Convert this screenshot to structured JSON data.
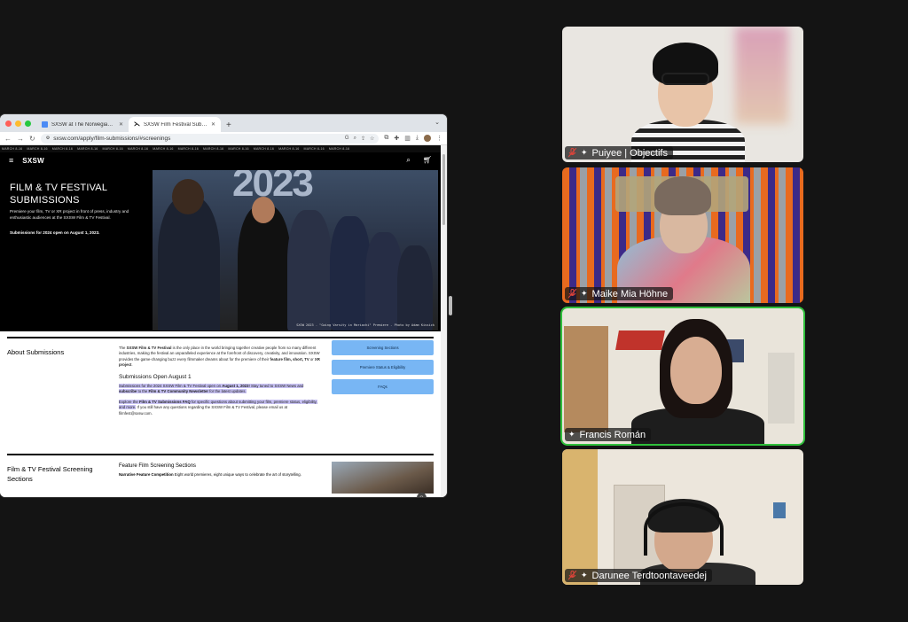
{
  "browser": {
    "tabs": [
      {
        "title": "SXSW at The Norwegian Short",
        "active": false
      },
      {
        "title": "SXSW Film Festival Submission",
        "active": true
      }
    ],
    "new_tab": "+",
    "url": "sxsw.com/apply/film-submissions/#screenings"
  },
  "site": {
    "ticker_item": "MARCH 8-16",
    "logo": "SXSW",
    "hero": {
      "title": "FILM & TV FESTIVAL SUBMISSIONS",
      "intro": "Premiere your film, TV or XR project in front of press, industry and enthusiastic audiences at the SXSW Film & TV Festival.",
      "open_note": "Submissions for 2024 open on August 1, 2023.",
      "photo_text": "2023",
      "caption": "SXSW 2023 - \"Going Varsity in Mariachi\" Premiere - Photo by Adam Kissick"
    },
    "about": {
      "heading": "About Submissions",
      "p1_a": "The ",
      "p1_b": "SXSW Film & TV Festival",
      "p1_c": " is the only place in the world bringing together creative people from so many different industries, making the festival an unparalleled experience at the forefront of discovery, creativity, and innovation. SXSW provides the game-changing buzz every filmmaker dreams about for the premiere of their ",
      "p1_d": "feature film, short, TV",
      "p1_e": " or ",
      "p1_f": "XR project",
      "p1_g": ".",
      "subheading": "Submissions Open August 1",
      "p2_a": "Submissions for the 2024 SXSW Film & TV Festival open on ",
      "p2_b": "August 1, 2023",
      "p2_c": "! Stay tuned to SXSW News and ",
      "p2_d": "subscribe",
      "p2_e": " to the ",
      "p2_f": "Film & TV Community Newsletter",
      "p2_g": " for the latest updates.",
      "p3_a": "Explore the ",
      "p3_b": "Film & TV Submissions FAQ",
      "p3_c": " for specific questions about submitting your film, premiere status, eligibility, and more.",
      "p3_d": " If you still have any questions regarding the SXSW Film & TV Festival, please email us at filmfest@sxsw.com.",
      "buttons": [
        "Screening Sections",
        "Premiere Status & Eligibility",
        "FAQs"
      ]
    },
    "screening": {
      "heading": "Film & TV Festival Screening Sections",
      "sub": "Feature Film Screening Sections",
      "item_bold": "Narrative Feature Competition",
      "item_text": " Eight world premieres, eight unique ways to celebrate the art of storytelling."
    }
  },
  "participants": [
    {
      "name": "Puiyee | Objectifs",
      "speaking": false
    },
    {
      "name": "Maike Mia Höhne",
      "speaking": false
    },
    {
      "name": "Francis Román",
      "speaking": true
    },
    {
      "name": "Darunee Terdtoontaveedej",
      "speaking": false
    }
  ],
  "colors": {
    "speaking_border": "#2fbf3b",
    "muted_mic": "#e0443a",
    "link_button": "#78b6f4",
    "highlight": "#c9c3f5"
  }
}
